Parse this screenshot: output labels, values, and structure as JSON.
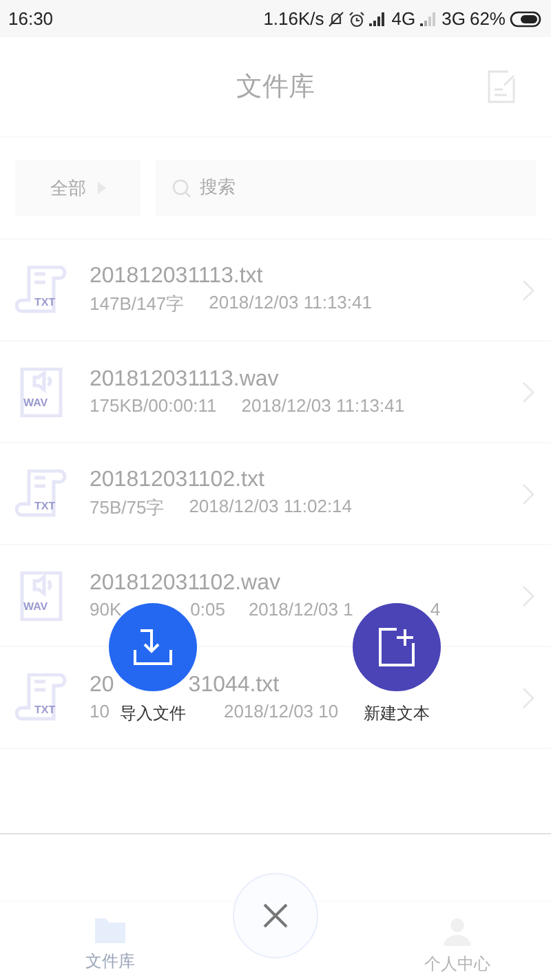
{
  "status_bar": {
    "time": "16:30",
    "speed": "1.16K/s",
    "network_1": "4G",
    "network_2": "3G",
    "battery": "62%"
  },
  "header": {
    "title": "文件库"
  },
  "filter": {
    "label": "全部"
  },
  "search": {
    "placeholder": "搜索"
  },
  "files": [
    {
      "kind": "txt",
      "badge": "TXT",
      "name": [
        "201812031113.txt"
      ],
      "meta": [
        "147B/147字",
        "2018/12/03 11:13:41"
      ]
    },
    {
      "kind": "wav",
      "badge": "WAV",
      "name": [
        "201812031113.wav"
      ],
      "meta": [
        "175KB/00:00:11",
        "2018/12/03 11:13:41"
      ]
    },
    {
      "kind": "txt",
      "badge": "TXT",
      "name": [
        "201812031102.txt"
      ],
      "meta": [
        "75B/75字",
        "2018/12/03 11:02:14"
      ]
    },
    {
      "kind": "wav",
      "badge": "WAV",
      "name": [
        "201812031102.wav"
      ],
      "meta": [
        "90K",
        "0:05",
        "2018/12/03 1",
        "4"
      ]
    },
    {
      "kind": "txt",
      "badge": "TXT",
      "name": [
        "20",
        "31044.txt"
      ],
      "meta": [
        "10",
        "2018/12/03 10"
      ]
    }
  ],
  "actions": [
    {
      "kind": "import",
      "label": "导入文件"
    },
    {
      "kind": "new",
      "label": "新建文本"
    }
  ],
  "tabs": [
    {
      "label": "文件库",
      "selected": true
    },
    {
      "label": "个人中心",
      "selected": false
    }
  ]
}
